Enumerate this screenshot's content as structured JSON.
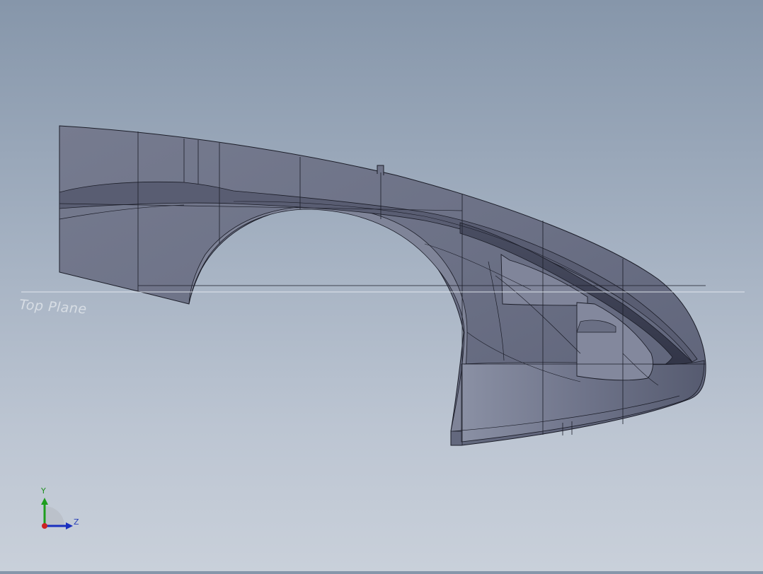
{
  "viewport": {
    "reference_plane_label": "Top Plane"
  },
  "triad": {
    "y_label": "Y",
    "z_label": "Z",
    "colors": {
      "y": "#1e9e1e",
      "z": "#1a2fbf",
      "origin": "#cc2222"
    }
  },
  "model": {
    "face_color": "#6f7489",
    "edge_color": "#1b1d28",
    "highlight_color": "#9aa0b4"
  }
}
